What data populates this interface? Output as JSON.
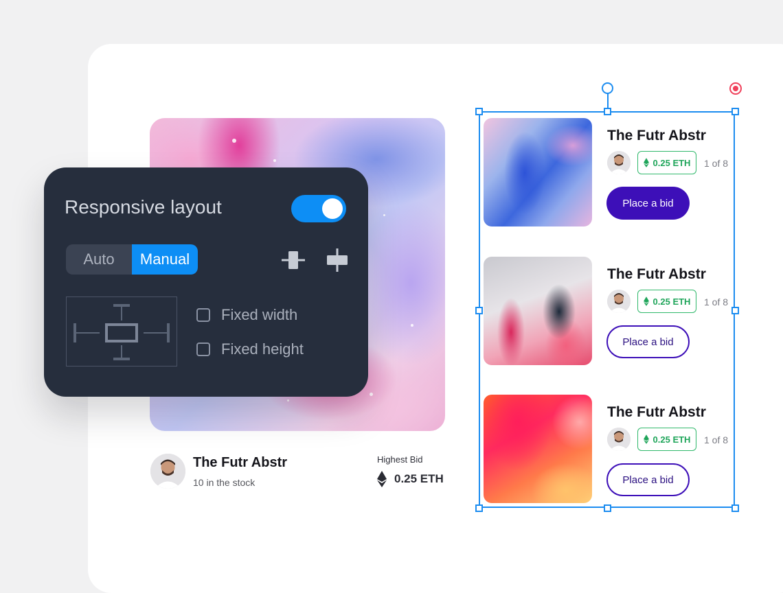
{
  "panel": {
    "title": "Responsive layout",
    "toggle_on": true,
    "mode_options": [
      "Auto",
      "Manual"
    ],
    "selected_mode": "Manual",
    "checkboxes": [
      {
        "label": "Fixed width",
        "checked": false
      },
      {
        "label": "Fixed height",
        "checked": false
      }
    ]
  },
  "featured": {
    "title": "The Futr Abstr",
    "stock": "10 in the stock",
    "bid_label": "Highest Bid",
    "bid_value": "0.25 ETH"
  },
  "cards": [
    {
      "title": "The Futr Abstr",
      "price": "0.25 ETH",
      "edition": "1 of 8",
      "button": "Place a bid",
      "style": "filled"
    },
    {
      "title": "The Futr Abstr",
      "price": "0.25 ETH",
      "edition": "1 of 8",
      "button": "Place a bid",
      "style": "outline"
    },
    {
      "title": "The Futr Abstr",
      "price": "0.25 ETH",
      "edition": "1 of 8",
      "button": "Place a bid",
      "style": "outline"
    }
  ],
  "colors": {
    "accent_blue": "#0d8ef5",
    "panel_bg": "#262e3d",
    "bid_purple": "#3d0fb8",
    "eth_green": "#1fa55a",
    "selection_blue": "#1b8cf0",
    "record_red": "#f0405a"
  },
  "icons": [
    "ethereum-icon",
    "align-horizontal-icon",
    "align-vertical-icon",
    "rotate-handle-icon",
    "record-icon"
  ]
}
